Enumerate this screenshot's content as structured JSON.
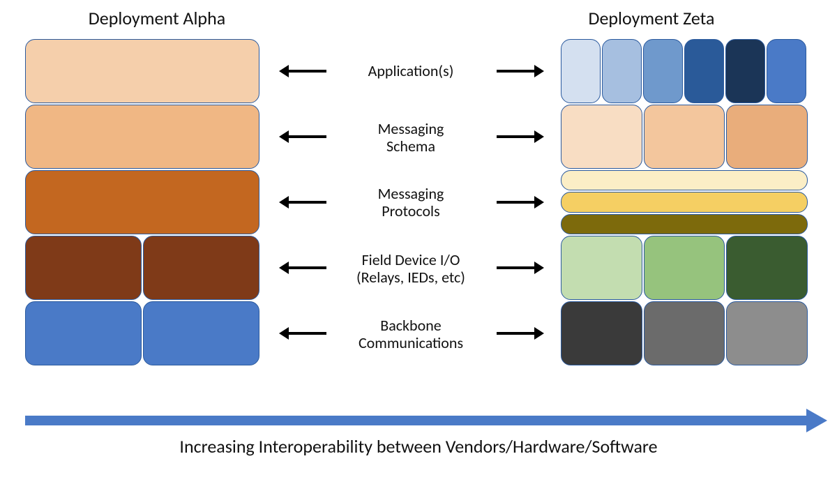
{
  "titles": {
    "left": "Deployment Alpha",
    "right": "Deployment Zeta"
  },
  "layers": {
    "l1": "Application(s)",
    "l2a": "Messaging",
    "l2b": "Schema",
    "l3a": "Messaging",
    "l3b": "Protocols",
    "l4a": "Field Device I/O",
    "l4b": "(Relays, IEDs, etc)",
    "l5a": "Backbone",
    "l5b": "Communications"
  },
  "caption": "Increasing Interoperability between Vendors/Hardware/Software",
  "colors": {
    "alpha": {
      "r1": "#f5cfab",
      "r2": "#f0b784",
      "r3": "#c36720",
      "r4": "#7f3a18",
      "r5": "#4a7ac7"
    },
    "zeta": {
      "row1": [
        "#d4e0f0",
        "#a6bfe0",
        "#6f99cc",
        "#2a5a99",
        "#1b3557",
        "#4a7ac7"
      ],
      "row2": [
        "#f8ddc3",
        "#f3c69d",
        "#e9ad7b"
      ],
      "row3": [
        "#fbeec6",
        "#f5cf63",
        "#7d6a0c"
      ],
      "row4": [
        "#c3ddb0",
        "#96c37d",
        "#3a5c30"
      ],
      "row5": [
        "#3a3a3a",
        "#6b6b6b",
        "#8d8d8d"
      ]
    },
    "arrow": "#4a7ac7"
  }
}
